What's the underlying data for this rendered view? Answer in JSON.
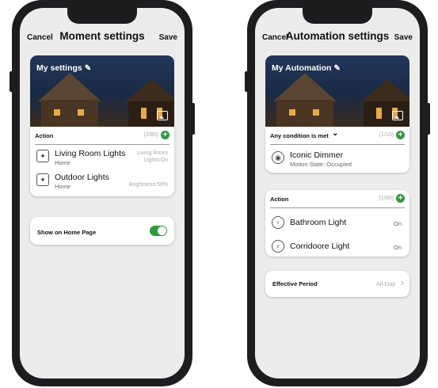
{
  "moment": {
    "header": {
      "cancel": "Cancel",
      "title": "Moment settings",
      "save": "Save"
    },
    "hero": {
      "title": "My settings"
    },
    "action": {
      "label": "Action",
      "count": "(2/80)",
      "items": [
        {
          "name": "Living Room Lights",
          "room": "Home",
          "status_line1": "Living Room",
          "status_line2": "Lights:On"
        },
        {
          "name": "Outdoor Lights",
          "room": "Home",
          "status": "Brightness:50%"
        }
      ]
    },
    "home_toggle": {
      "label": "Show on Home Page"
    }
  },
  "automation": {
    "header": {
      "cancel": "Cancel",
      "title": "Automation settings",
      "save": "Save"
    },
    "hero": {
      "title": "My Automation"
    },
    "condition": {
      "label": "Any condition is met",
      "count": "(1/10)",
      "items": [
        {
          "name": "Iconic Dimmer",
          "sub": "Motion State: Occupied"
        }
      ]
    },
    "action": {
      "label": "Action",
      "count": "(1/80)",
      "items": [
        {
          "name": "Bathroom Light",
          "state": "On"
        },
        {
          "name": "Corridoore Light",
          "state": "On"
        }
      ]
    },
    "period": {
      "label": "Effective Period",
      "value": "All-Day"
    }
  },
  "colors": {
    "accent": "#2d9b3e",
    "muted": "#a9a9a9"
  }
}
